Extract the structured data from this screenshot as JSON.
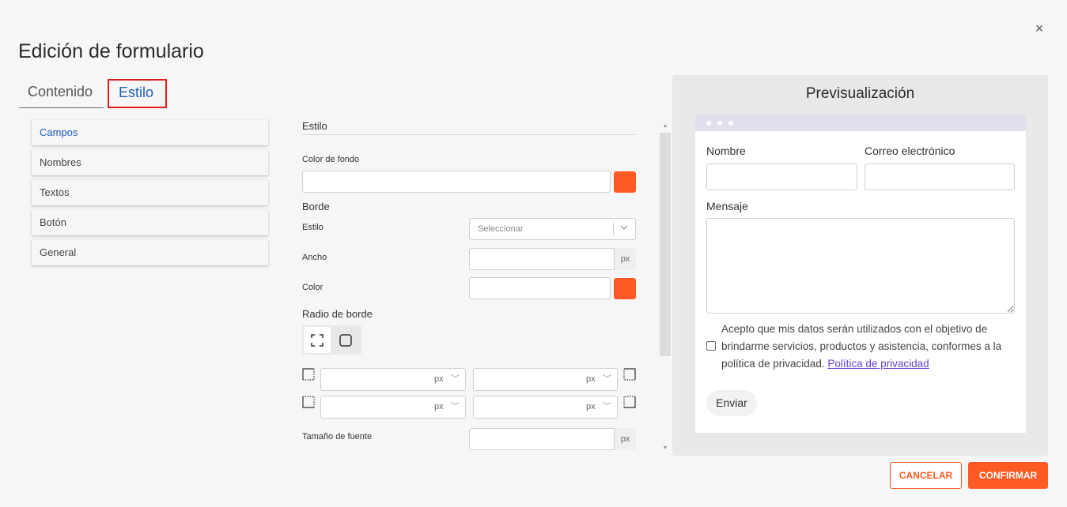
{
  "dialog": {
    "title": "Edición de formulario",
    "close_label": "×"
  },
  "tabs": [
    {
      "label": "Contenido"
    },
    {
      "label": "Estilo",
      "active": true
    }
  ],
  "sidebar": {
    "items": [
      {
        "label": "Campos",
        "active": true
      },
      {
        "label": "Nombres"
      },
      {
        "label": "Textos"
      },
      {
        "label": "Botón"
      },
      {
        "label": "General"
      }
    ]
  },
  "style_panel": {
    "section_title": "Estilo",
    "background_color_label": "Color de fondo",
    "background_color_value": "",
    "background_color_swatch": "#ff5a24",
    "border_heading": "Borde",
    "border_style_label": "Estilo",
    "border_style_placeholder": "Seleccionar",
    "border_width_label": "Ancho",
    "border_width_unit": "px",
    "border_color_label": "Color",
    "border_color_swatch": "#ff5a24",
    "radius_heading": "Radio de borde",
    "radius_icons": [
      "expand-corners-icon",
      "rounded-square-icon"
    ],
    "corner_unit": "px",
    "font_size_label": "Tamaño de fuente",
    "font_size_unit": "px"
  },
  "preview": {
    "title": "Previsualización",
    "fields": {
      "name_label": "Nombre",
      "email_label": "Correo electrónico",
      "message_label": "Mensaje"
    },
    "consent_text": "Acepto que mis datos serán utilizados con el objetivo de brindarme servicios, productos y asistencia, conformes a la política de privacidad.",
    "privacy_link": "Política de privacidad",
    "submit_label": "Enviar"
  },
  "footer": {
    "cancel_label": "CANCELAR",
    "confirm_label": "CONFIRMAR"
  },
  "colors": {
    "accent": "#ff5a24",
    "link": "#1f5fb8",
    "highlight_box": "#e21b1b"
  }
}
